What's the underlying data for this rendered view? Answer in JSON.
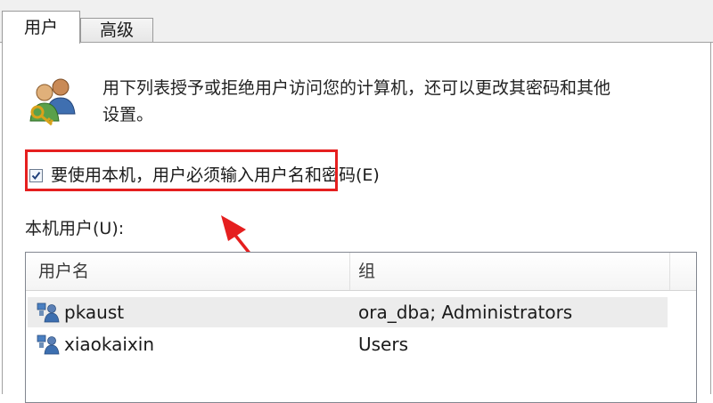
{
  "tabs": [
    {
      "label": "用户",
      "active": true
    },
    {
      "label": "高级",
      "active": false
    }
  ],
  "description": {
    "line1": "用下列表授予或拒绝用户访问您的计算机，还可以更改其密码和其他",
    "line2": "设置。"
  },
  "require_password": {
    "label": "要使用本机，用户必须输入用户名和密码(E)",
    "checked": true
  },
  "local_users": {
    "label": "本机用户(U):",
    "columns": [
      "用户名",
      "组"
    ],
    "rows": [
      {
        "name": "pkaust",
        "group": "ora_dba; Administrators",
        "selected": true
      },
      {
        "name": "xiaokaixin",
        "group": "Users",
        "selected": false
      }
    ]
  },
  "colors": {
    "highlight": "#e51f1f",
    "selection": "#ececec"
  },
  "icons": {
    "header": "users-key-icon",
    "row": "user-icon"
  }
}
